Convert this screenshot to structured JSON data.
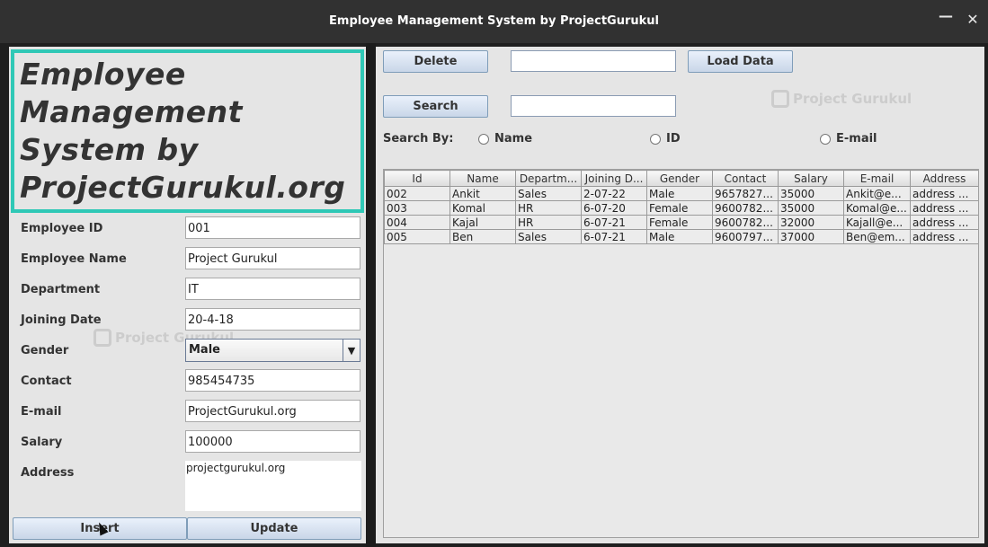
{
  "window": {
    "title": "Employee Management System by ProjectGurukul",
    "minimize_glyph": "—",
    "close_glyph": "✕"
  },
  "heading": {
    "lines": [
      "Employee",
      "Management",
      "System by",
      "ProjectGurukul.org"
    ]
  },
  "form": {
    "employee_id": {
      "label": "Employee ID",
      "value": "001"
    },
    "employee_name": {
      "label": "Employee Name",
      "value": "Project Gurukul"
    },
    "department": {
      "label": "Department",
      "value": "IT"
    },
    "joining_date": {
      "label": "Joining Date",
      "value": "20-4-18"
    },
    "gender": {
      "label": "Gender",
      "value": "Male"
    },
    "contact": {
      "label": "Contact",
      "value": "985454735"
    },
    "email": {
      "label": "E-mail",
      "value": "ProjectGurukul.org"
    },
    "salary": {
      "label": "Salary",
      "value": "100000"
    },
    "address": {
      "label": "Address",
      "value": "projectgurukul.org"
    }
  },
  "buttons": {
    "insert": "Insert",
    "update": "Update",
    "delete": "Delete",
    "load_data": "Load Data",
    "search": "Search"
  },
  "search": {
    "by_label": "Search By:",
    "options": [
      "Name",
      "ID",
      "E-mail"
    ]
  },
  "table": {
    "columns": [
      "Id",
      "Name",
      "Departm...",
      "Joining D...",
      "Gender",
      "Contact",
      "Salary",
      "E-mail",
      "Address"
    ],
    "rows": [
      [
        "002",
        "Ankit",
        "Sales",
        "2-07-22",
        "Male",
        "9657827...",
        "35000",
        "Ankit@e...",
        "address ..."
      ],
      [
        "003",
        "Komal",
        "HR",
        "6-07-20",
        "Female",
        "9600782...",
        "35000",
        "Komal@e...",
        "address ..."
      ],
      [
        "004",
        "Kajal",
        "HR",
        "6-07-21",
        "Female",
        "9600782...",
        "32000",
        "Kajall@e...",
        "address ..."
      ],
      [
        "005",
        "Ben",
        "Sales",
        "6-07-21",
        "Male",
        "9600797...",
        "37000",
        "Ben@em...",
        "address ..."
      ]
    ]
  },
  "watermark": "Project Gurukul",
  "colors": {
    "heading_border": "#2fc8b6",
    "titlebar": "#313131",
    "panel": "#e5e5e5"
  }
}
